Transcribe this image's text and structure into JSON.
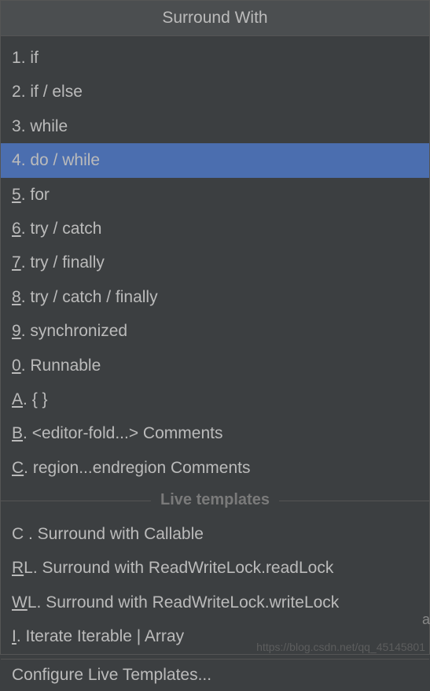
{
  "header": {
    "title": "Surround With"
  },
  "items": [
    {
      "key": "1",
      "underline": false,
      "label": "if",
      "selected": false
    },
    {
      "key": "2",
      "underline": false,
      "label": "if / else",
      "selected": false
    },
    {
      "key": "3",
      "underline": false,
      "label": "while",
      "selected": false
    },
    {
      "key": "4",
      "underline": false,
      "label": "do / while",
      "selected": true
    },
    {
      "key": "5",
      "underline": true,
      "label": "for",
      "selected": false
    },
    {
      "key": "6",
      "underline": true,
      "label": "try / catch",
      "selected": false
    },
    {
      "key": "7",
      "underline": true,
      "label": "try / finally",
      "selected": false
    },
    {
      "key": "8",
      "underline": true,
      "label": "try / catch / finally",
      "selected": false
    },
    {
      "key": "9",
      "underline": true,
      "label": "synchronized",
      "selected": false
    },
    {
      "key": "0",
      "underline": true,
      "label": "Runnable",
      "selected": false
    },
    {
      "key": "A",
      "underline": true,
      "label": "{ }",
      "selected": false
    },
    {
      "key": "B",
      "underline": true,
      "label": "<editor-fold...> Comments",
      "selected": false
    },
    {
      "key": "C",
      "underline": true,
      "label": "region...endregion Comments",
      "selected": false
    }
  ],
  "section": {
    "title": "Live templates"
  },
  "liveTemplates": [
    {
      "key": "C ",
      "underline": false,
      "label": "Surround with Callable"
    },
    {
      "key": "R",
      "suffix": "L",
      "underline": true,
      "label": "Surround with ReadWriteLock.readLock"
    },
    {
      "key": "W",
      "suffix": "L",
      "underline": true,
      "label": "Surround with ReadWriteLock.writeLock"
    },
    {
      "key": "I",
      "underline": true,
      "label": "Iterate Iterable | Array"
    }
  ],
  "footer": {
    "configure": "Configure Live Templates..."
  },
  "watermark": "https://blog.csdn.net/qq_45145801"
}
